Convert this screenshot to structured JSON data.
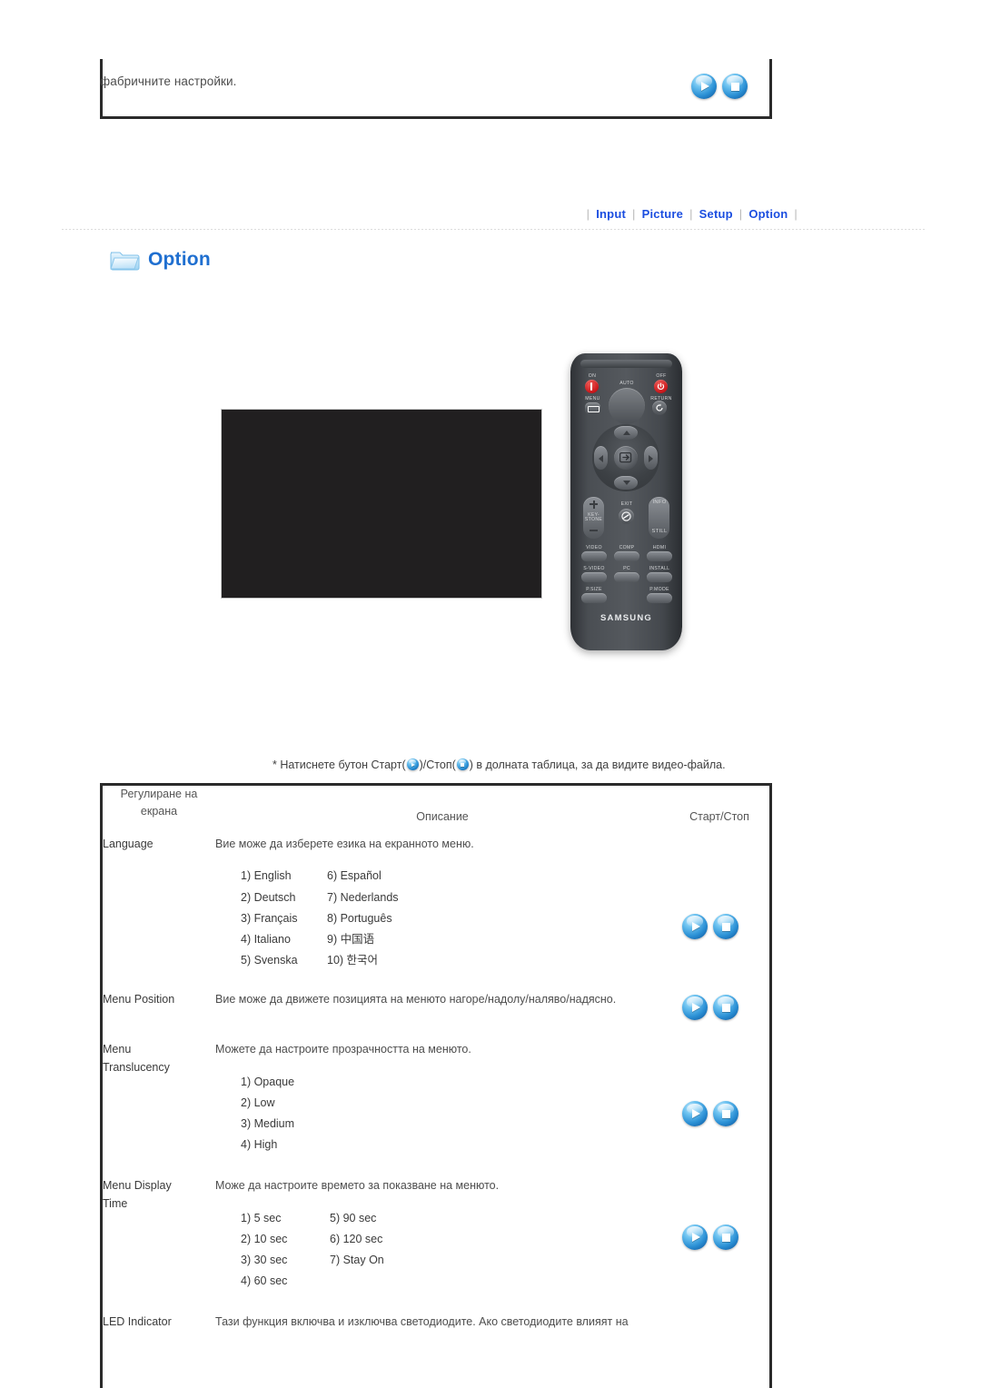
{
  "top_box": {
    "text": "фабричните настройки.",
    "play_label": "Старт",
    "stop_label": "Стоп"
  },
  "nav": {
    "items": [
      {
        "label": "Input"
      },
      {
        "label": "Picture"
      },
      {
        "label": "Setup"
      },
      {
        "label": "Option"
      }
    ],
    "separator": "|"
  },
  "section": {
    "icon": "folder-icon",
    "title": "Option"
  },
  "remote": {
    "labels": {
      "on": "ON",
      "auto": "AUTO",
      "off": "OFF",
      "menu": "MENU",
      "return": "RETURN",
      "keystone": "KEY-\nSTONE",
      "keystone_line1": "KEY-",
      "keystone_line2": "STONE",
      "exit": "EXIT",
      "info": "INFO",
      "still": "STILL",
      "video": "VIDEO",
      "comp": "COMP",
      "hdmi": "HDMI",
      "svideo": "S-VIDEO",
      "pc": "PC",
      "install": "INSTALL",
      "psize": "P.SIZE",
      "pmode": "P.MODE",
      "brand": "SAMSUNG"
    }
  },
  "note": {
    "prefix": "* Натиснете бутон Старт(",
    "middle": ")/Стоп(",
    "suffix": ") в долната таблица, за да видите видео-файла."
  },
  "table": {
    "headers": {
      "name_line1": "Регулиране на",
      "name_line2": "екрана",
      "description": "Описание",
      "control": "Старт/Стоп"
    },
    "rows": [
      {
        "name_line1": "Language",
        "name_line2": "",
        "description": "Вие може да изберете езика на екранното меню.",
        "options_left": [
          "1) English",
          "2) Deutsch",
          "3) Français",
          "4) Italiano",
          "5) Svenska"
        ],
        "options_right": [
          "6) Español",
          "7) Nederlands",
          "8) Português",
          "9) 中国语",
          "10) 한국어"
        ],
        "has_controls": true
      },
      {
        "name_line1": "Menu Position",
        "name_line2": "",
        "description": "Вие може да движете позицията на менюто нагоре/надолу/наляво/надясно.",
        "options_left": [],
        "options_right": [],
        "has_controls": true
      },
      {
        "name_line1": "Menu",
        "name_line2": "Translucency",
        "description": "Можете да настроите прозрачността на менюто.",
        "options_left": [
          "1) Opaque",
          "2) Low",
          "3) Medium",
          "4) High"
        ],
        "options_right": [],
        "has_controls": true
      },
      {
        "name_line1": "Menu Display",
        "name_line2": "Time",
        "description": "Може да настроите времето за показване на менюто.",
        "options_left": [
          "1) 5 sec",
          "2) 10 sec",
          "3) 30 sec",
          "4) 60 sec"
        ],
        "options_right": [
          "5) 90 sec",
          "6) 120 sec",
          "7) Stay On"
        ],
        "has_controls": true
      },
      {
        "name_line1": "LED Indicator",
        "name_line2": "",
        "description": "Тази функция включва и изключва светодиодите. Ако светодиодите влияят на",
        "options_left": [],
        "options_right": [],
        "has_controls": false
      }
    ]
  },
  "colors": {
    "accent_blue": "#1b4ee0",
    "title_blue": "#1f6fd0",
    "border_dark": "#2b2b2b",
    "video_black": "#211f20"
  }
}
